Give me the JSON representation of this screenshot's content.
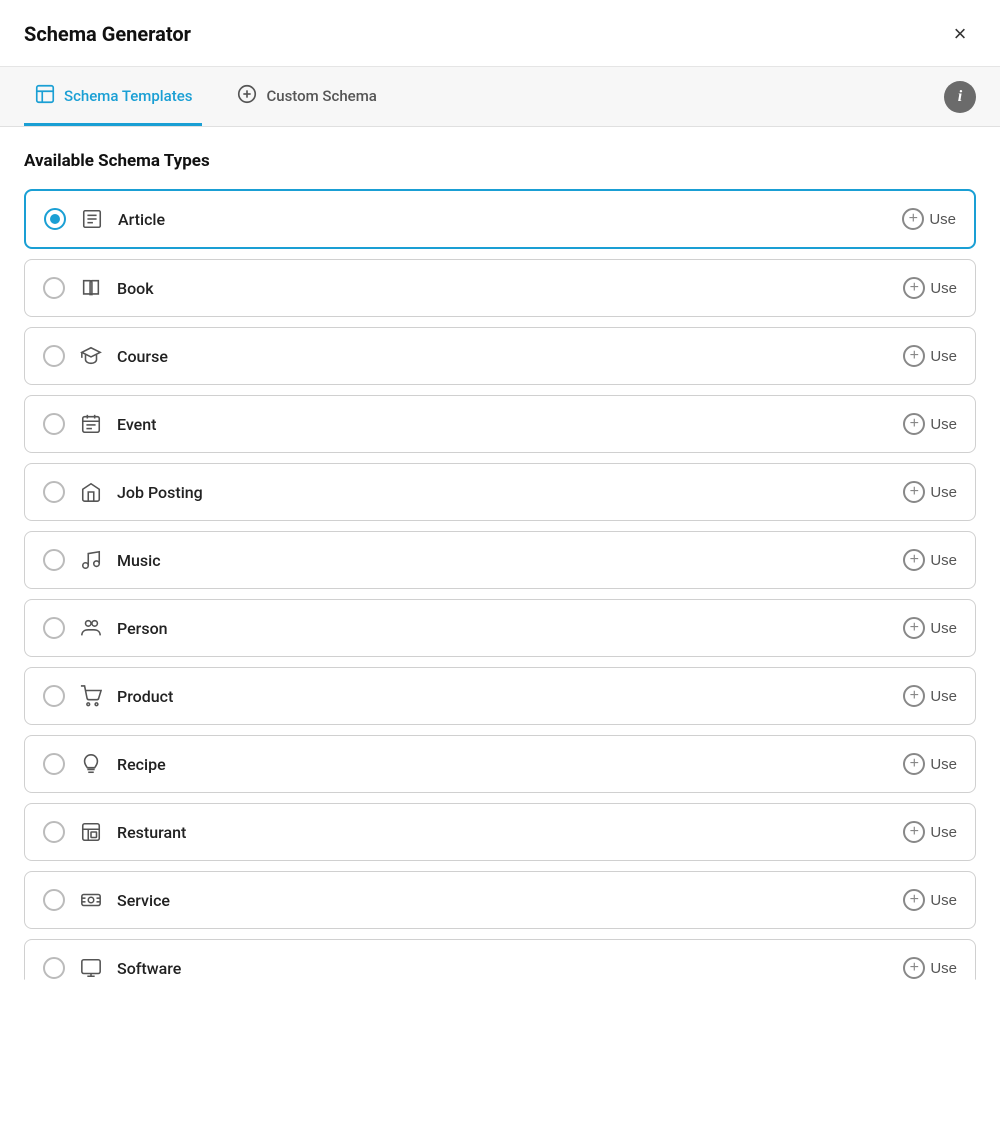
{
  "header": {
    "title": "Schema Generator",
    "close_label": "×"
  },
  "tabs": [
    {
      "id": "schema-templates",
      "label": "Schema Templates",
      "icon": "template-icon",
      "active": true
    },
    {
      "id": "custom-schema",
      "label": "Custom Schema",
      "icon": "plus-icon",
      "active": false
    }
  ],
  "info_button_label": "i",
  "section_title": "Available Schema Types",
  "schema_items": [
    {
      "id": "article",
      "label": "Article",
      "icon": "article-icon",
      "selected": true
    },
    {
      "id": "book",
      "label": "Book",
      "icon": "book-icon",
      "selected": false
    },
    {
      "id": "course",
      "label": "Course",
      "icon": "course-icon",
      "selected": false
    },
    {
      "id": "event",
      "label": "Event",
      "icon": "event-icon",
      "selected": false
    },
    {
      "id": "job-posting",
      "label": "Job Posting",
      "icon": "job-icon",
      "selected": false
    },
    {
      "id": "music",
      "label": "Music",
      "icon": "music-icon",
      "selected": false
    },
    {
      "id": "person",
      "label": "Person",
      "icon": "person-icon",
      "selected": false
    },
    {
      "id": "product",
      "label": "Product",
      "icon": "product-icon",
      "selected": false
    },
    {
      "id": "recipe",
      "label": "Recipe",
      "icon": "recipe-icon",
      "selected": false
    },
    {
      "id": "restaurant",
      "label": "Resturant",
      "icon": "restaurant-icon",
      "selected": false
    },
    {
      "id": "service",
      "label": "Service",
      "icon": "service-icon",
      "selected": false
    },
    {
      "id": "software",
      "label": "Software",
      "icon": "software-icon",
      "selected": false
    }
  ],
  "use_label": "Use"
}
